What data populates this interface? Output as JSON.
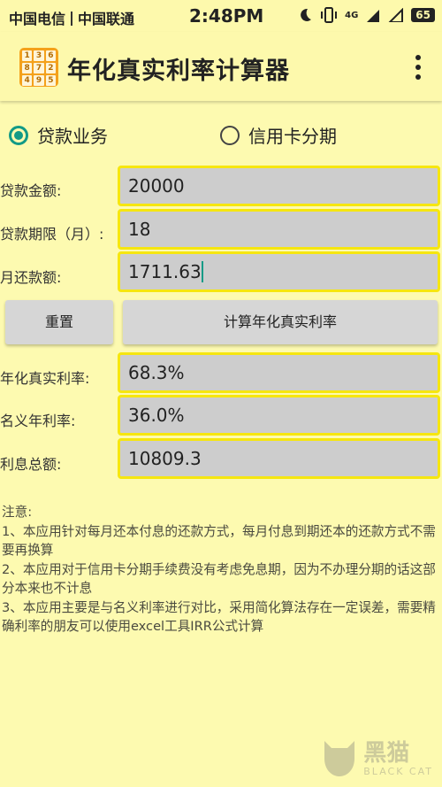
{
  "status_bar": {
    "carrier1": "中国电信",
    "carrier2": "中国联通",
    "time": "2:48PM",
    "network": "4G",
    "battery": "65"
  },
  "app": {
    "title": "年化真实利率计算器",
    "logo_digits": [
      "1",
      "3",
      "6",
      "8",
      "7",
      "2",
      "4",
      "9",
      "5"
    ]
  },
  "mode": {
    "options": [
      "贷款业务",
      "信用卡分期"
    ],
    "selected": "贷款业务"
  },
  "inputs": {
    "amount": {
      "label": "贷款金额:",
      "value": "20000"
    },
    "term": {
      "label": "贷款期限（月）:",
      "value": "18"
    },
    "payment": {
      "label": "月还款额:",
      "value": "1711.63"
    }
  },
  "buttons": {
    "reset": "重置",
    "calculate": "计算年化真实利率"
  },
  "results": {
    "real_rate": {
      "label": "年化真实利率:",
      "value": "68.3%"
    },
    "nominal_rate": {
      "label": "名义年利率:",
      "value": "36.0%"
    },
    "total_interest": {
      "label": "利息总额:",
      "value": "10809.3"
    }
  },
  "notes": {
    "title": "注意:",
    "items": [
      "1、本应用针对每月还本付息的还款方式，每月付息到期还本的还款方式不需要再换算",
      "2、本应用对于信用卡分期手续费没有考虑免息期，因为不办理分期的话这部分本来也不计息",
      "3、本应用主要是与名义利率进行对比，采用简化算法存在一定误差，需要精确利率的朋友可以使用excel工具IRR公式计算"
    ]
  },
  "watermark": {
    "text": "黑猫",
    "sub": "BLACK CAT"
  },
  "colors": {
    "background": "#fdfab0",
    "accent": "#129a86",
    "field_border": "#f6e60f",
    "field_bg": "#cdcdcd"
  }
}
